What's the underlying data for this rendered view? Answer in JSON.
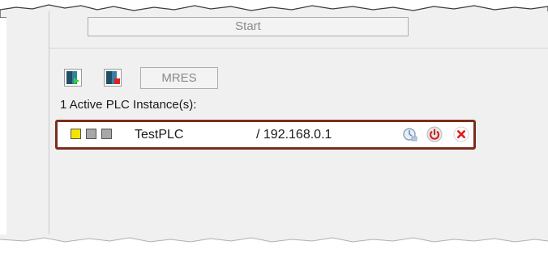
{
  "toolbar": {
    "start_label": "Start",
    "mres_label": "MRES",
    "run_icon": "plc-run-icon",
    "stop_icon": "plc-stop-icon"
  },
  "instances": {
    "heading": "1 Active PLC Instance(s):",
    "items": [
      {
        "leds": [
          "yellow",
          "gray",
          "gray"
        ],
        "name": "TestPLC",
        "address": "/ 192.168.0.1",
        "actions": [
          "refresh-clock-icon",
          "power-icon",
          "close-icon"
        ]
      }
    ]
  },
  "colors": {
    "highlight_border": "#7b2d1c",
    "led_yellow": "#f3e500",
    "led_gray": "#a8a8a8",
    "power_red": "#d02828",
    "close_red": "#e02020"
  }
}
